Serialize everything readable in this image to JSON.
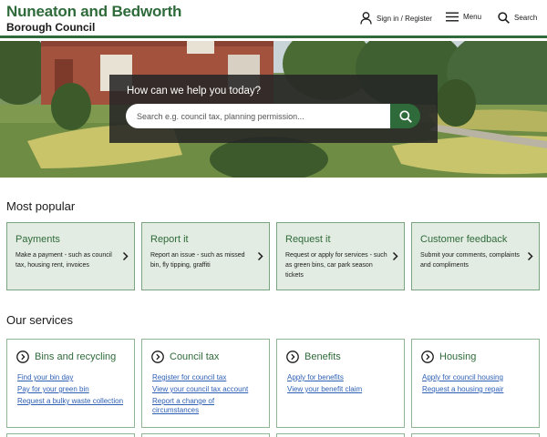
{
  "header": {
    "logo_line1": "Nuneaton and Bedworth",
    "logo_line2": "Borough Council",
    "sign_in": "Sign in / Register",
    "menu": "Menu",
    "search": "Search"
  },
  "hero": {
    "heading": "How can we help you today?",
    "search_placeholder": "Search e.g. council tax, planning permission..."
  },
  "most_popular": {
    "title": "Most popular",
    "cards": [
      {
        "title": "Payments",
        "desc": "Make a payment - such as council tax, housing rent, invoices"
      },
      {
        "title": "Report it",
        "desc": "Report an issue - such as missed bin, fly tipping, graffiti"
      },
      {
        "title": "Request it",
        "desc": "Request or apply for services - such as green bins, car park season tickets"
      },
      {
        "title": "Customer feedback",
        "desc": "Submit your comments, complaints and compliments"
      }
    ]
  },
  "services": {
    "title": "Our services",
    "cards": [
      {
        "title": "Bins and recycling",
        "links": [
          "Find your bin day",
          "Pay for your green bin",
          "Request a bulky waste collection"
        ]
      },
      {
        "title": "Council tax",
        "links": [
          "Register for council tax",
          "View your council tax account",
          "Report a change of circumstances"
        ]
      },
      {
        "title": "Benefits",
        "links": [
          "Apply for benefits",
          "View your benefit claim"
        ]
      },
      {
        "title": "Housing",
        "links": [
          "Apply for council housing",
          "Request a housing repair"
        ]
      }
    ]
  },
  "colors": {
    "brand_green": "#2f6b3a",
    "card_bg": "#e3ece3",
    "link_blue": "#2d5fb5"
  }
}
